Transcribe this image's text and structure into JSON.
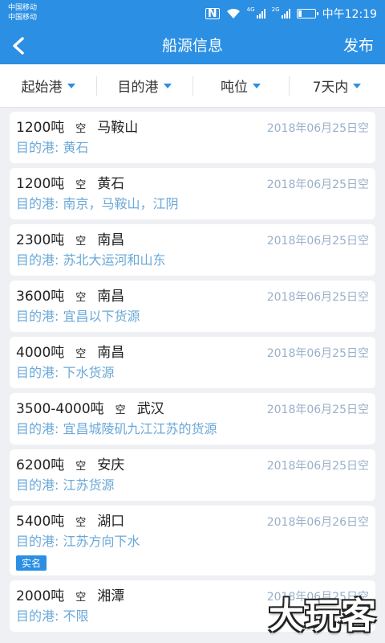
{
  "status_bar": {
    "carrier1": "中国移动",
    "carrier2": "中国移动",
    "network1": "4G",
    "network2": "2G",
    "time": "中午12:19"
  },
  "nav": {
    "title": "船源信息",
    "publish": "发布",
    "back_icon": "back-arrow-icon"
  },
  "filters": [
    {
      "label": "起始港"
    },
    {
      "label": "目的港"
    },
    {
      "label": "吨位"
    },
    {
      "label": "7天内"
    }
  ],
  "dest_prefix": "目的港: ",
  "listings": [
    {
      "tonnage": "1200吨",
      "status": "空",
      "port": "马鞍山",
      "date": "2018年06月25日空",
      "dest": "黄石"
    },
    {
      "tonnage": "1200吨",
      "status": "空",
      "port": "黄石",
      "date": "2018年06月25日空",
      "dest": "南京，马鞍山，江阴"
    },
    {
      "tonnage": "2300吨",
      "status": "空",
      "port": "南昌",
      "date": "2018年06月25日空",
      "dest": "苏北大运河和山东"
    },
    {
      "tonnage": "3600吨",
      "status": "空",
      "port": "南昌",
      "date": "2018年06月25日空",
      "dest": "宜昌以下货源"
    },
    {
      "tonnage": "4000吨",
      "status": "空",
      "port": "南昌",
      "date": "2018年06月25日空",
      "dest": "下水货源"
    },
    {
      "tonnage": "3500-4000吨",
      "status": "空",
      "port": "武汉",
      "date": "2018年06月25日空",
      "dest": "宜昌城陵矶九江江苏的货源"
    },
    {
      "tonnage": "6200吨",
      "status": "空",
      "port": "安庆",
      "date": "2018年06月25日空",
      "dest": "江苏货源"
    },
    {
      "tonnage": "5400吨",
      "status": "空",
      "port": "湖口",
      "date": "2018年06月26日空",
      "dest": "江苏方向下水",
      "badge": "实名"
    },
    {
      "tonnage": "2000吨",
      "status": "空",
      "port": "湘潭",
      "date": "2018年06月25日空",
      "dest": "不限"
    }
  ],
  "watermark": "大玩客",
  "colors": {
    "brand": "#2b8fe3",
    "dest_text": "#6aa8d8",
    "date_text": "#9ab0c8"
  }
}
